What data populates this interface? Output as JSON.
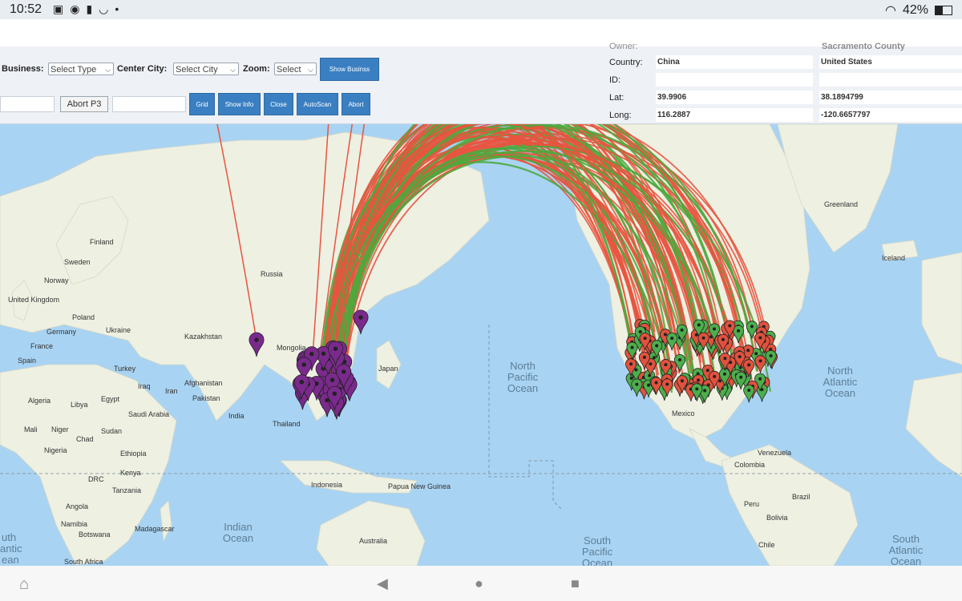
{
  "status_bar": {
    "time": "10:52",
    "battery": "42%",
    "icons": [
      "image-icon",
      "message-icon",
      "sd-card-icon",
      "smile-icon",
      "dot-icon"
    ]
  },
  "toolbar": {
    "business_label": "Business:",
    "business_value": "Select Type",
    "center_city_label": "Center City:",
    "center_city_value": "Select City",
    "zoom_label": "Zoom:",
    "zoom_value": "Select",
    "show_button": "Show Businss",
    "abort_button": "Abort P3",
    "grid_button": "Grid",
    "show_info_button": "Show Info",
    "close_button": "Close",
    "autoscan_button": "AutoScan",
    "abort_button2": "Abort"
  },
  "info_panel": {
    "owner_label": "Owner:",
    "owner_a": "",
    "owner_b": "Sacramento County",
    "country_label": "Country:",
    "country_a": "China",
    "country_b": "United States",
    "id_label": "ID:",
    "id_a": "",
    "id_b": "",
    "lat_label": "Lat:",
    "lat_a": "39.9906",
    "lat_b": "38.1894799",
    "long_label": "Long:",
    "long_a": "116.2887",
    "long_b": "-120.6657797"
  },
  "map": {
    "colors": {
      "ocean": "#a9d3f2",
      "land": "#eef0e2",
      "route_red": "#e8543f",
      "route_green": "#4daa3d",
      "marker_purple": "#7a2a8c",
      "marker_red": "#e0523e",
      "marker_green": "#4cae4c"
    },
    "country_labels": {
      "finland": "Finland",
      "sweden": "Sweden",
      "norway": "Norway",
      "russia": "Russia",
      "united_kingdom": "United Kingdom",
      "poland": "Poland",
      "germany": "Germany",
      "ukraine": "Ukraine",
      "france": "France",
      "spain": "Spain",
      "kazakhstan": "Kazakhstan",
      "mongolia": "Mongolia",
      "turkey": "Turkey",
      "iraq": "Iraq",
      "iran": "Iran",
      "afghanistan": "Afghanistan",
      "pakistan": "Pakistan",
      "india": "India",
      "thailand": "Thailand",
      "japan": "Japan",
      "algeria": "Algeria",
      "libya": "Libya",
      "egypt": "Egypt",
      "saudi_arabia": "Saudi Arabia",
      "mali": "Mali",
      "niger": "Niger",
      "chad": "Chad",
      "sudan": "Sudan",
      "nigeria": "Nigeria",
      "ethiopia": "Ethiopia",
      "kenya": "Kenya",
      "drc": "DRC",
      "tanzania": "Tanzania",
      "angola": "Angola",
      "namibia": "Namibia",
      "botswana": "Botswana",
      "madagascar": "Madagascar",
      "south_africa": "South Africa",
      "indonesia": "Indonesia",
      "papua_new_guinea": "Papua New Guinea",
      "australia": "Australia",
      "greenland": "Greenland",
      "iceland": "Iceland",
      "mexico": "Mexico",
      "venezuela": "Venezuela",
      "colombia": "Colombia",
      "peru": "Peru",
      "brazil": "Brazil",
      "bolivia": "Bolivia",
      "chile": "Chile"
    },
    "ocean_labels": {
      "north_pacific": [
        "North",
        "Pacific",
        "Ocean"
      ],
      "north_atlantic": [
        "North",
        "Atlantic",
        "Ocean"
      ],
      "indian": [
        "Indian",
        "Ocean"
      ],
      "south_pacific": [
        "South",
        "Pacific",
        "Ocean"
      ],
      "south_atlantic": [
        "South",
        "Atlantic",
        "Ocean"
      ],
      "atlantic_left": [
        "uth",
        "antic",
        "ean"
      ]
    }
  },
  "nav": {
    "home_icon": "home-icon",
    "back_icon": "back-icon",
    "overview_icon": "overview-icon",
    "recents_icon": "recents-icon"
  }
}
